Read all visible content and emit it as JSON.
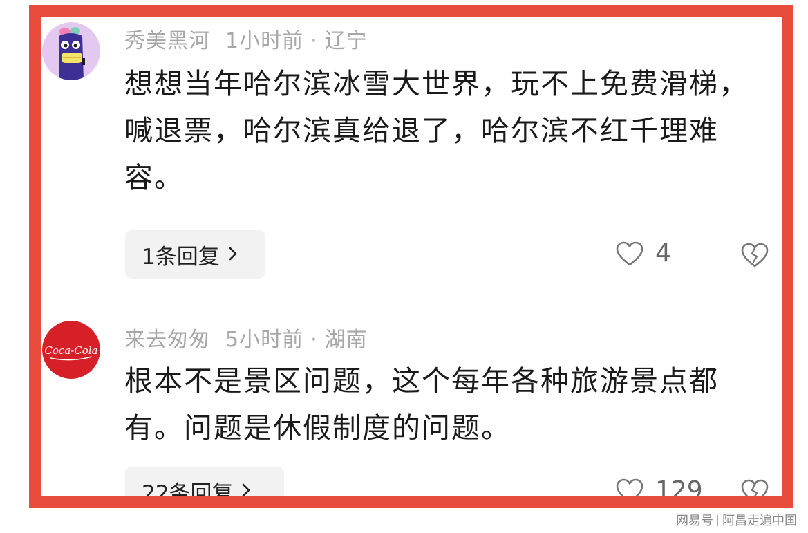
{
  "comments": [
    {
      "username": "秀美黑河",
      "time": "1小时前",
      "dot": "·",
      "location": "辽宁",
      "text": "想想当年哈尔滨冰雪大世界，玩不上免费滑梯，喊退票，哈尔滨真给退了，哈尔滨不红千理难容。",
      "replies_label": "1条回复",
      "like_count": "4",
      "avatar_icon": "purple-cartoon-character-avatar"
    },
    {
      "username": "来去匆匆",
      "time": "5小时前",
      "dot": "·",
      "location": "湖南",
      "text": "根本不是景区问题，这个每年各种旅游景点都有。问题是休假制度的问题。",
      "replies_label": "22条回复",
      "like_count": "129",
      "avatar_icon": "coca-cola-logo-avatar",
      "avatar_logo_text": "Coca-Cola"
    }
  ],
  "icons": {
    "chevron": "chevron-right-icon",
    "like": "heart-outline-icon",
    "dislike": "broken-heart-icon"
  },
  "colors": {
    "frame_border": "#e84c3d",
    "meta_text": "#a7a7a7",
    "reply_bg": "#f2f2f2"
  },
  "watermark": {
    "left": "网易号",
    "right": "阿昌走遍中国"
  }
}
